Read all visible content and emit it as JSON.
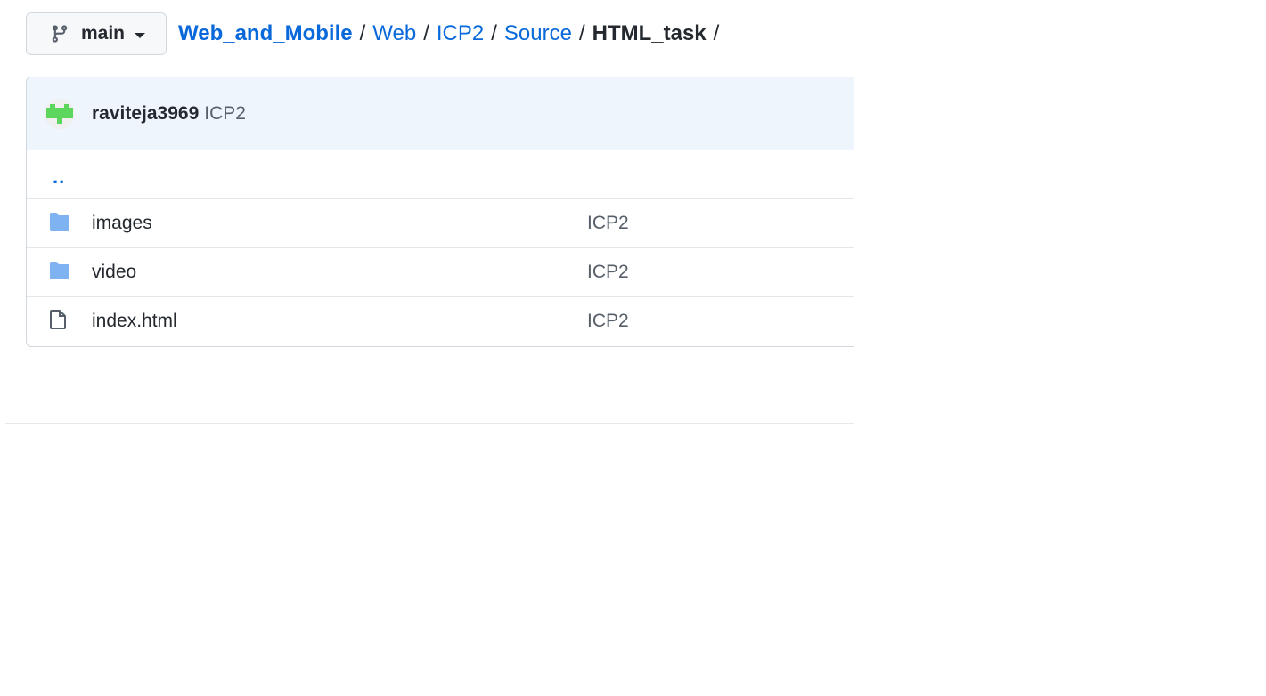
{
  "branch": {
    "label": "main",
    "icon": "git-branch-icon"
  },
  "breadcrumb": {
    "root": "Web_and_Mobile",
    "segments": [
      "Web",
      "ICP2",
      "Source"
    ],
    "separator": "/",
    "current": "HTML_task"
  },
  "commit": {
    "author": "raviteja3969",
    "message": "ICP2"
  },
  "parent_link": "..",
  "files": [
    {
      "type": "folder",
      "icon": "folder-icon",
      "name": "images",
      "message": "ICP2"
    },
    {
      "type": "folder",
      "icon": "folder-icon",
      "name": "video",
      "message": "ICP2"
    },
    {
      "type": "file",
      "icon": "file-icon",
      "name": "index.html",
      "message": "ICP2"
    }
  ],
  "colors": {
    "link": "#0969da",
    "header_bg": "#eef5fd",
    "folder": "#7fb2f0",
    "avatar_green": "#5cd65c"
  }
}
